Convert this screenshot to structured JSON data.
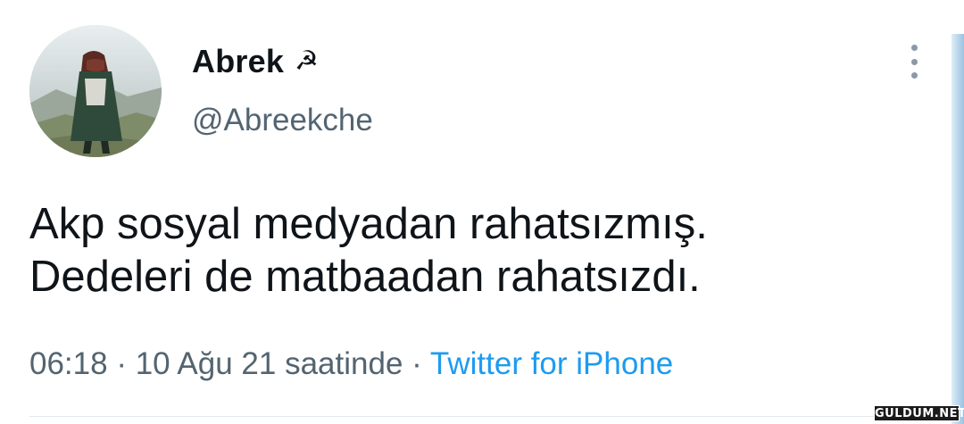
{
  "tweet": {
    "author": {
      "display_name": "Abrek",
      "name_emoji": "☭",
      "handle": "@Abreekche",
      "avatar_icon": "user-avatar-photo"
    },
    "text_lines": [
      "Akp sosyal medyadan rahatsızmış.",
      "Dedeleri de matbaadan rahatsızdı."
    ],
    "meta": {
      "time": "06:18",
      "separator": " · ",
      "date": "10 Ağu 21 saatinde",
      "source": "Twitter for iPhone"
    },
    "more_icon": "more-vertical-icon"
  },
  "watermark": "GULDUM.NET",
  "colors": {
    "text": "#0f1419",
    "secondary": "#536471",
    "link": "#1d9bf0"
  }
}
